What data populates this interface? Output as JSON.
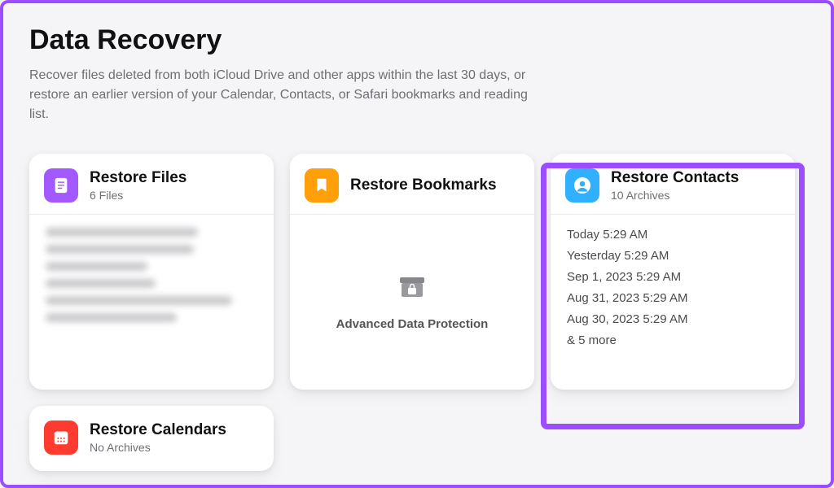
{
  "page": {
    "title": "Data Recovery",
    "description": "Recover files deleted from both iCloud Drive and other apps within the last 30 days, or restore an earlier version of your Calendar, Contacts, or Safari bookmarks and reading list."
  },
  "cards": {
    "files": {
      "title": "Restore Files",
      "subtitle": "6 Files"
    },
    "bookmarks": {
      "title": "Restore Bookmarks",
      "adp_label": "Advanced Data Protection"
    },
    "contacts": {
      "title": "Restore Contacts",
      "subtitle": "10 Archives",
      "archives": {
        "a0": "Today 5:29 AM",
        "a1": "Yesterday 5:29 AM",
        "a2": "Sep 1, 2023 5:29 AM",
        "a3": "Aug 31, 2023 5:29 AM",
        "a4": "Aug 30, 2023 5:29 AM",
        "more": "& 5 more"
      }
    },
    "calendars": {
      "title": "Restore Calendars",
      "subtitle": "No Archives"
    }
  },
  "colors": {
    "accent_highlight": "#9b4dff"
  }
}
